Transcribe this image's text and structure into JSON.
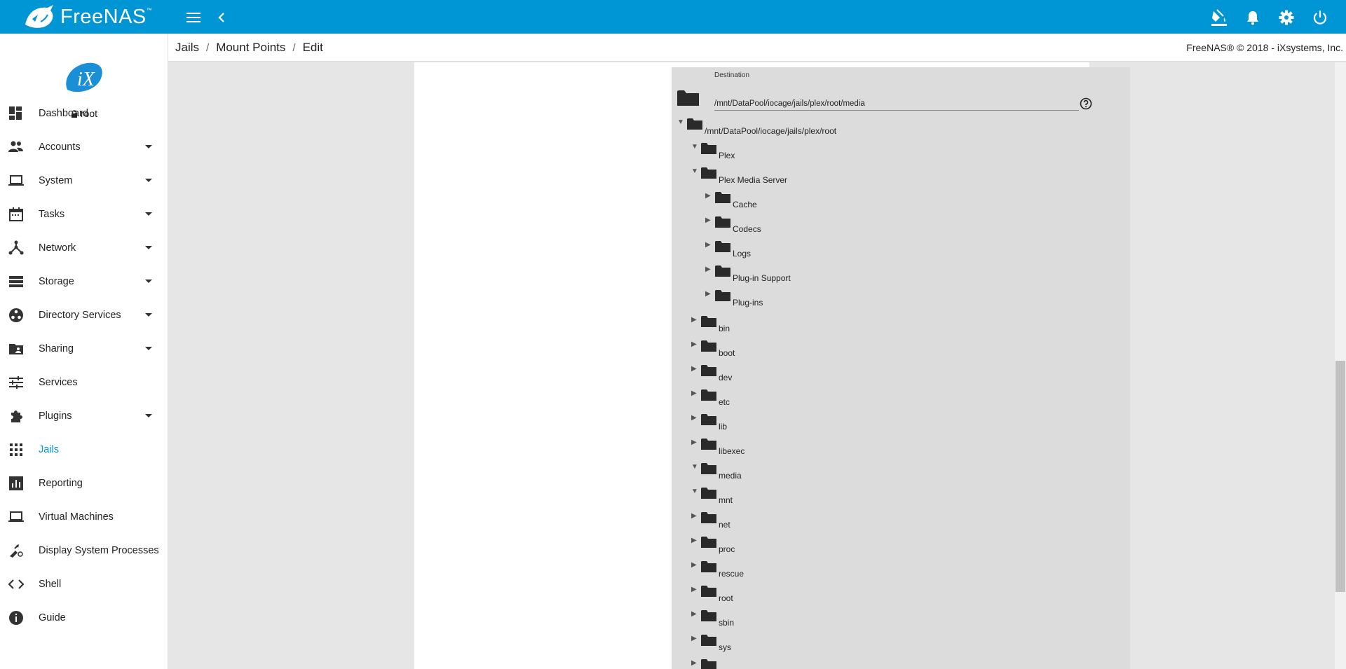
{
  "app": {
    "brand": "FreeNAS",
    "trademark": "™"
  },
  "header": {
    "icons": [
      "menu-icon",
      "back-icon",
      "theme-icon",
      "notifications-icon",
      "settings-icon",
      "power-icon"
    ]
  },
  "breadcrumb": {
    "items": [
      "Jails",
      "Mount Points",
      "Edit"
    ],
    "separator": "/"
  },
  "copyright": "FreeNAS® © 2018 - iXsystems, Inc.",
  "user": {
    "name": "root",
    "avatar_text": "iX"
  },
  "sidebar": {
    "items": [
      {
        "label": "Dashboard",
        "icon": "dashboard-icon",
        "has_caret": false
      },
      {
        "label": "Accounts",
        "icon": "accounts-icon",
        "has_caret": true
      },
      {
        "label": "System",
        "icon": "system-icon",
        "has_caret": true
      },
      {
        "label": "Tasks",
        "icon": "tasks-icon",
        "has_caret": true
      },
      {
        "label": "Network",
        "icon": "network-icon",
        "has_caret": true
      },
      {
        "label": "Storage",
        "icon": "storage-icon",
        "has_caret": true
      },
      {
        "label": "Directory Services",
        "icon": "directory-services-icon",
        "has_caret": true
      },
      {
        "label": "Sharing",
        "icon": "sharing-icon",
        "has_caret": true
      },
      {
        "label": "Services",
        "icon": "services-icon",
        "has_caret": false
      },
      {
        "label": "Plugins",
        "icon": "plugins-icon",
        "has_caret": true
      },
      {
        "label": "Jails",
        "icon": "jails-icon",
        "has_caret": false,
        "active": true
      },
      {
        "label": "Reporting",
        "icon": "reporting-icon",
        "has_caret": false
      },
      {
        "label": "Virtual Machines",
        "icon": "virtual-machines-icon",
        "has_caret": false
      },
      {
        "label": "Display System Processes",
        "icon": "system-processes-icon",
        "has_caret": false
      },
      {
        "label": "Shell",
        "icon": "shell-icon",
        "has_caret": false
      },
      {
        "label": "Guide",
        "icon": "guide-icon",
        "has_caret": false
      }
    ]
  },
  "form": {
    "destination_label": "Destination",
    "destination_value": "/mnt/DataPool/iocage/jails/plex/root/media"
  },
  "tree": [
    {
      "label": "/mnt/DataPool/iocage/jails/plex/root",
      "depth": 0,
      "expanded": true
    },
    {
      "label": "Plex",
      "depth": 1,
      "expanded": true
    },
    {
      "label": "Plex Media Server",
      "depth": 1,
      "expanded": true
    },
    {
      "label": "Cache",
      "depth": 2,
      "expanded": false
    },
    {
      "label": "Codecs",
      "depth": 2,
      "expanded": false
    },
    {
      "label": "Logs",
      "depth": 2,
      "expanded": false
    },
    {
      "label": "Plug-in Support",
      "depth": 2,
      "expanded": false
    },
    {
      "label": "Plug-ins",
      "depth": 2,
      "expanded": false
    },
    {
      "label": "bin",
      "depth": 1,
      "expanded": false
    },
    {
      "label": "boot",
      "depth": 1,
      "expanded": false
    },
    {
      "label": "dev",
      "depth": 1,
      "expanded": false
    },
    {
      "label": "etc",
      "depth": 1,
      "expanded": false
    },
    {
      "label": "lib",
      "depth": 1,
      "expanded": false
    },
    {
      "label": "libexec",
      "depth": 1,
      "expanded": false
    },
    {
      "label": "media",
      "depth": 1,
      "expanded": true
    },
    {
      "label": "mnt",
      "depth": 1,
      "expanded": true
    },
    {
      "label": "net",
      "depth": 1,
      "expanded": false
    },
    {
      "label": "proc",
      "depth": 1,
      "expanded": false
    },
    {
      "label": "rescue",
      "depth": 1,
      "expanded": false
    },
    {
      "label": "root",
      "depth": 1,
      "expanded": false
    },
    {
      "label": "sbin",
      "depth": 1,
      "expanded": false
    },
    {
      "label": "sys",
      "depth": 1,
      "expanded": false
    },
    {
      "label": "",
      "depth": 1,
      "expanded": false
    }
  ],
  "colors": {
    "brand": "#0095d5",
    "panel": "#dcdcdc",
    "folder": "#2a2a2a"
  }
}
